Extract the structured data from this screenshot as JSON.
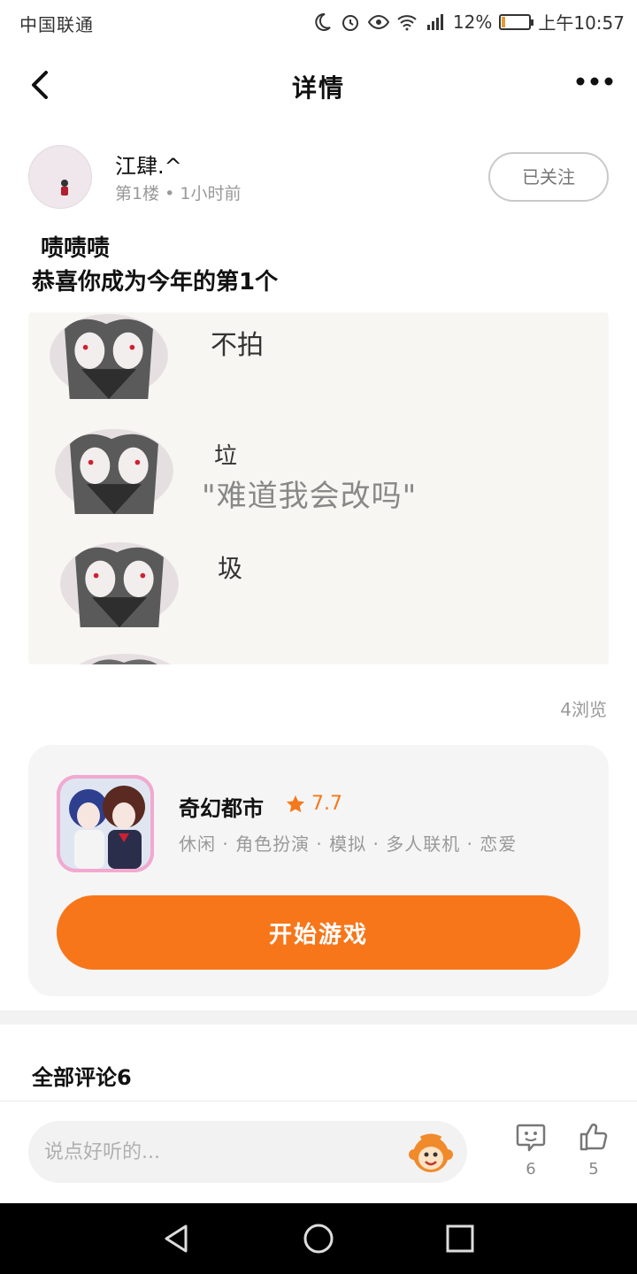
{
  "status_bar": {
    "carrier": "中国联通",
    "battery": "12%",
    "time": "上午10:57",
    "battery_level": 0.12
  },
  "nav": {
    "title": "详情"
  },
  "author": {
    "name": "江肆.^",
    "floor": "第1楼",
    "time_ago": "1小时前",
    "follow_label": "已关注"
  },
  "post": {
    "line1": "啧啧啧",
    "line2": "恭喜你成为今年的第1个",
    "image": {
      "captions": [
        "不拍",
        "垃",
        "圾"
      ],
      "quote": "\"难道我会改吗\""
    },
    "views": "4浏览"
  },
  "game_card": {
    "name": "奇幻都市",
    "rating": "7.7",
    "tags": "休闲 · 角色扮演 · 模拟 · 多人联机 · 恋爱",
    "play_label": "开始游戏"
  },
  "comments": {
    "title": "全部评论6"
  },
  "bottom_bar": {
    "input_placeholder": "说点好听的...",
    "comment_count": "6",
    "like_count": "5"
  },
  "colors": {
    "accent": "#f7761a",
    "card_bg": "#f5f5f5"
  }
}
